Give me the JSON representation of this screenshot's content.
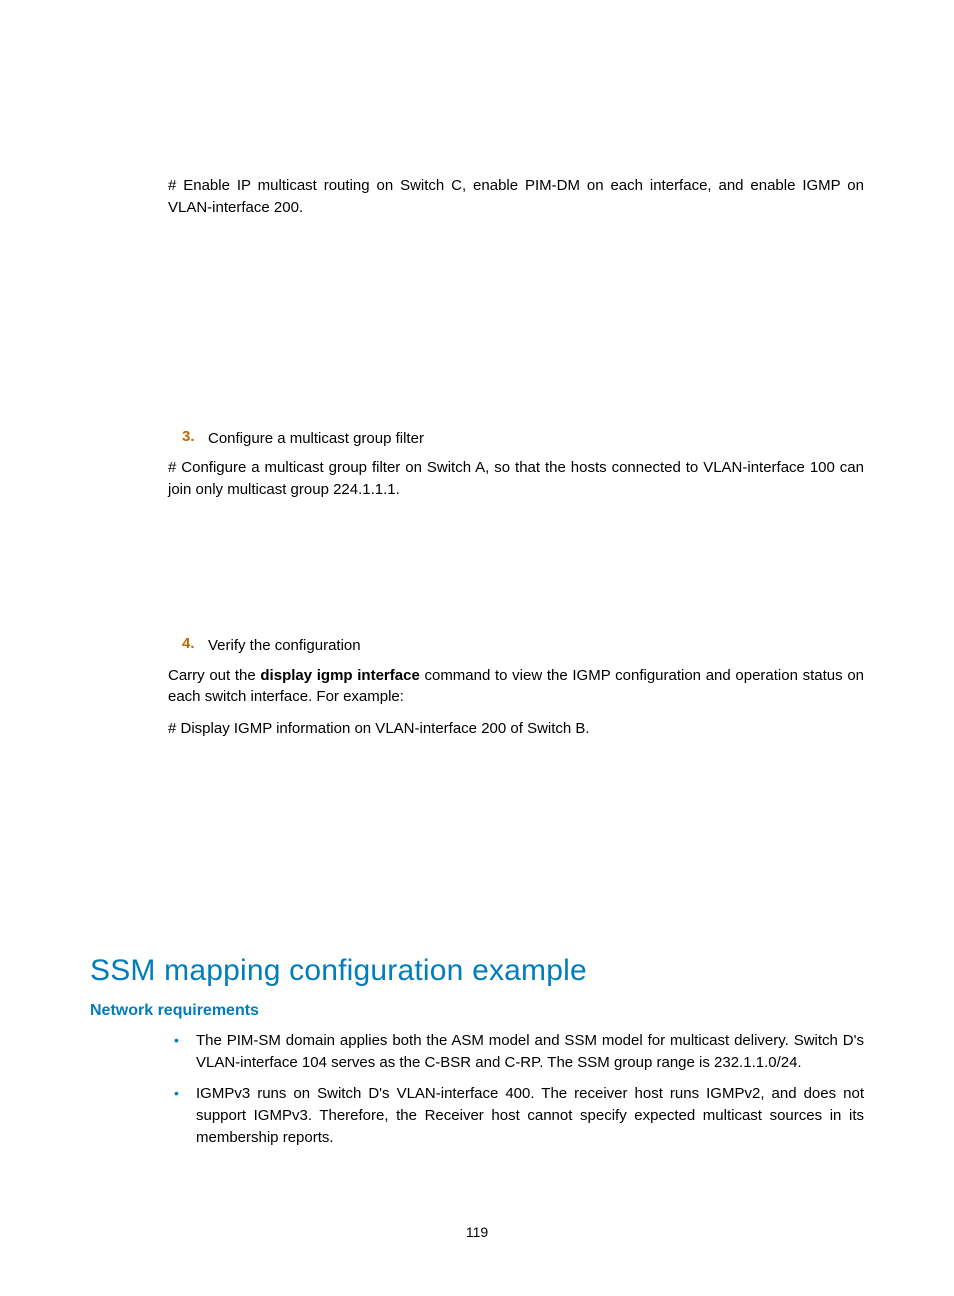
{
  "para1": "# Enable IP multicast routing on Switch C, enable PIM-DM on each interface, and enable IGMP on VLAN-interface 200.",
  "step3_num": "3.",
  "step3_label": "Configure a multicast group filter",
  "step3_text": "# Configure a multicast group filter on Switch A, so that the hosts connected to VLAN-interface 100 can join only multicast group 224.1.1.1.",
  "step4_num": "4.",
  "step4_label": "Verify the configuration",
  "step4_text_pre": "Carry out the ",
  "step4_text_bold": "display igmp interface",
  "step4_text_post": " command to view the IGMP configuration and operation status on each switch interface. For example:",
  "step4_text2": "# Display IGMP information on VLAN-interface 200 of Switch B.",
  "heading1": "SSM mapping configuration example",
  "heading2": "Network requirements",
  "bullet1": "The PIM-SM domain applies both the ASM model and SSM model for multicast delivery. Switch D's VLAN-interface 104 serves as the C-BSR and C-RP. The SSM group range is 232.1.1.0/24.",
  "bullet2": "IGMPv3 runs on Switch D's VLAN-interface 400. The receiver host runs IGMPv2, and does not support IGMPv3. Therefore, the Receiver host cannot specify expected multicast sources in its membership reports.",
  "bullet_glyph": "•",
  "page_number": "119"
}
